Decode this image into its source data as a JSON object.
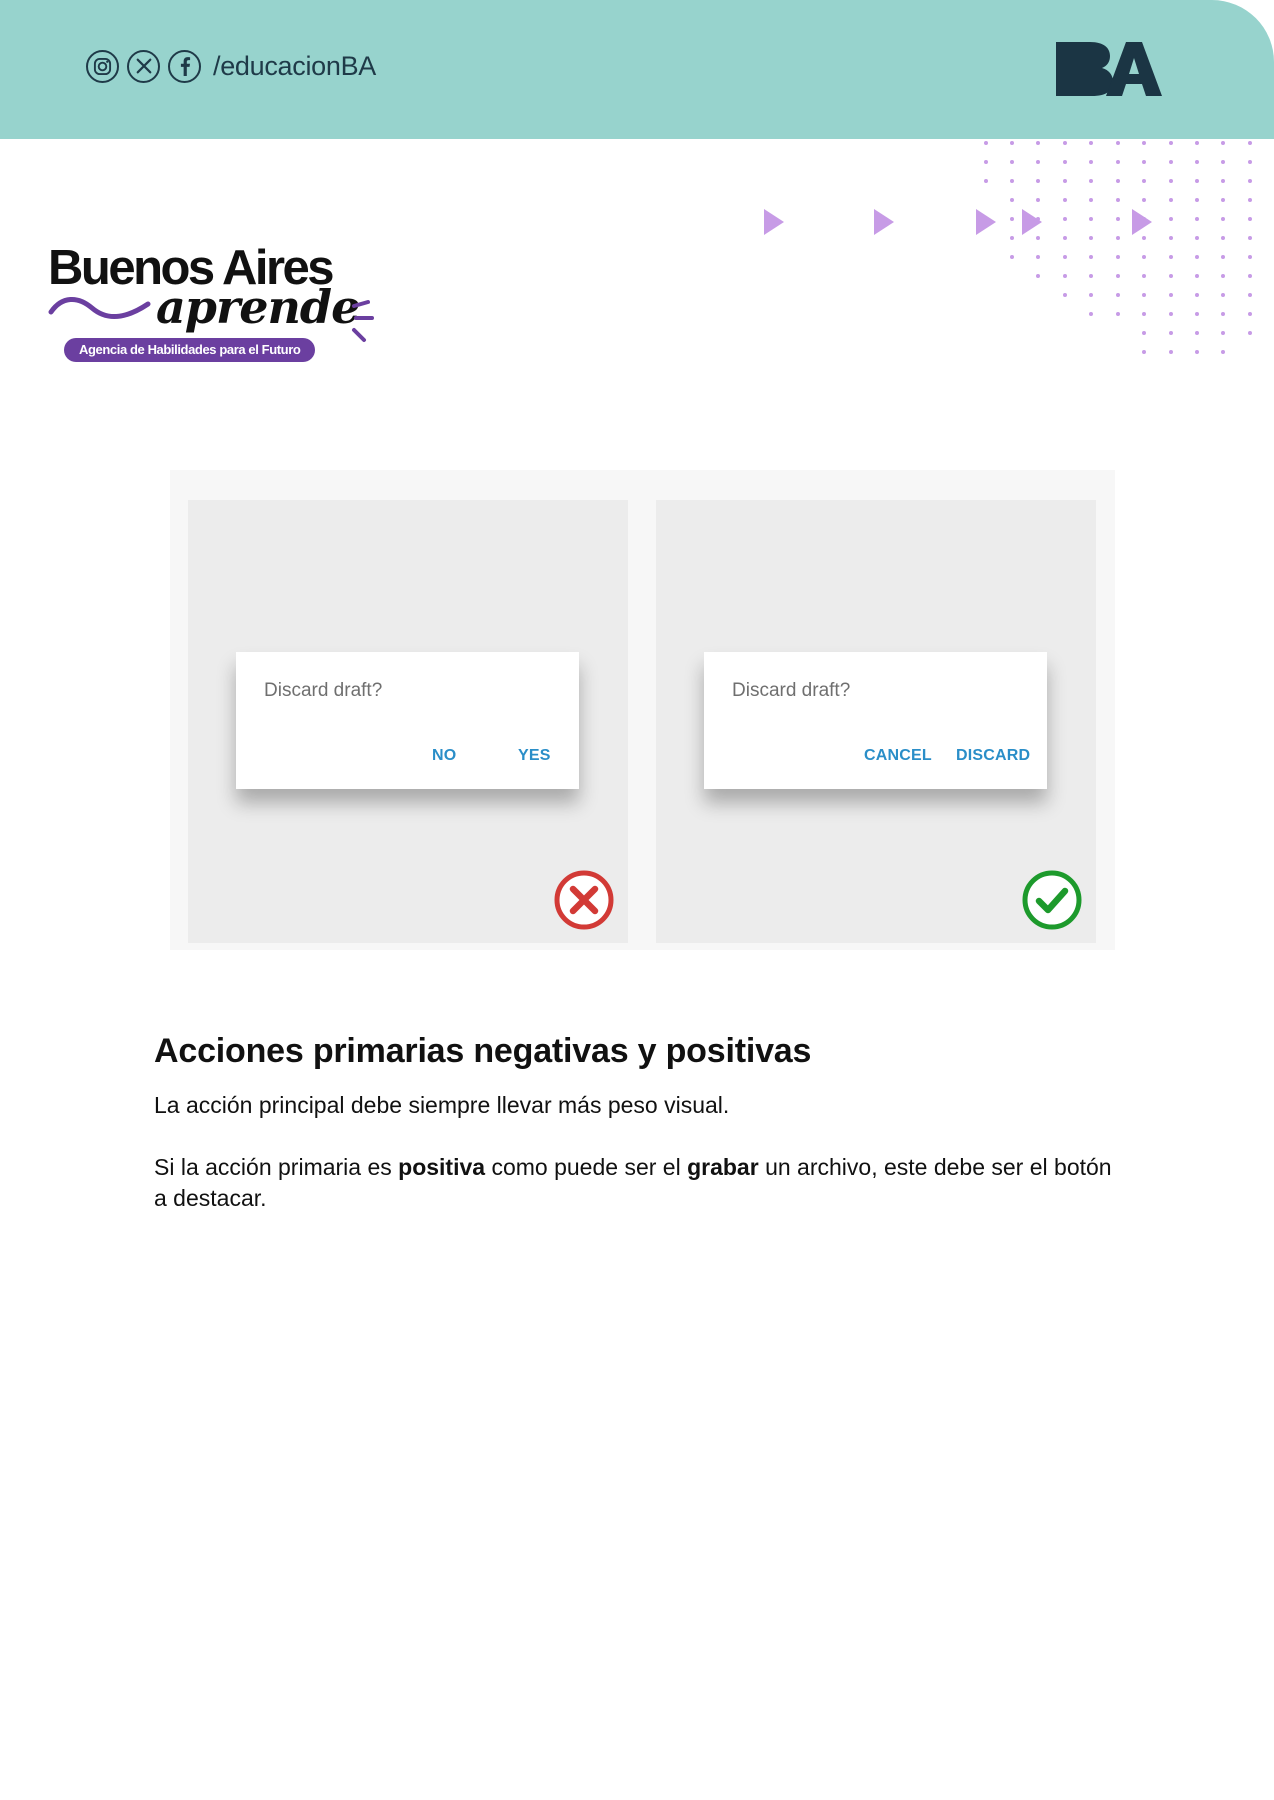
{
  "header": {
    "social_icons": [
      "instagram-icon",
      "x-icon",
      "facebook-icon"
    ],
    "handle": "/educacionBA",
    "logo_text": "BA",
    "band_color": "#97d3cd"
  },
  "brand": {
    "title": "Buenos Aires",
    "script": "aprende",
    "tagline": "Agencia de Habilidades para el Futuro",
    "accent_color": "#6b3fa0"
  },
  "figure": {
    "bad_example": {
      "question": "Discard draft?",
      "buttons": [
        "NO",
        "YES"
      ],
      "mark_icon": "red-x-icon"
    },
    "good_example": {
      "question": "Discard draft?",
      "buttons": [
        "CANCEL",
        "DISCARD"
      ],
      "mark_icon": "green-check-icon"
    },
    "button_color": "#2a8ec8"
  },
  "content": {
    "heading": "Acciones primarias negativas y positivas",
    "para1": "La acción principal debe siempre llevar más peso visual.",
    "para2": {
      "t1": "Si la acción primaria es ",
      "b1": "positiva",
      "t2": " como puede ser el ",
      "b2": "grabar",
      "t3": " un archivo, este debe ser el botón a destacar."
    }
  }
}
